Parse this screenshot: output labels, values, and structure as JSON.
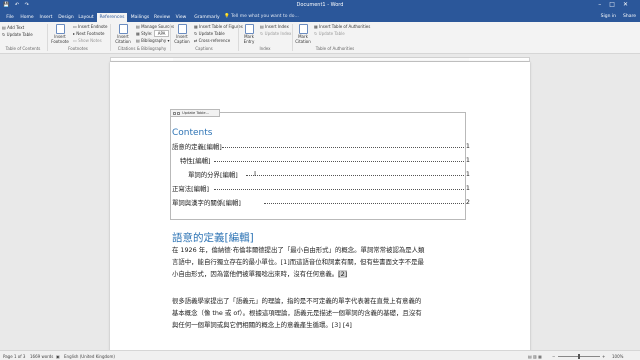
{
  "window": {
    "title": "Document1 - Word",
    "controls": {
      "minimize": "–",
      "maximize": "□",
      "close": "✕"
    }
  },
  "qat": {
    "icons": [
      "save-icon",
      "undo-icon",
      "redo-icon"
    ]
  },
  "tabs": [
    {
      "label": "File"
    },
    {
      "label": "Home"
    },
    {
      "label": "Insert"
    },
    {
      "label": "Design"
    },
    {
      "label": "Layout"
    },
    {
      "label": "References",
      "active": true
    },
    {
      "label": "Mailings"
    },
    {
      "label": "Review"
    },
    {
      "label": "View"
    },
    {
      "label": "Grammarly"
    }
  ],
  "tell_me": "Tell me what you want to do...",
  "sign_in": "Sign in",
  "share": "Share",
  "ribbon": {
    "toc": {
      "add_text": "Add Text",
      "update_table": "Update Table",
      "table_of_contents": "Table of Contents",
      "group": "Table of Contents"
    },
    "footnotes": {
      "insert_footnote": "Insert Footnote",
      "insert_endnote": "Insert Endnote",
      "next_footnote": "Next Footnote",
      "show_notes": "Show Notes",
      "group": "Footnotes"
    },
    "citations": {
      "insert_citation": "Insert Citation",
      "manage_sources": "Manage Sources",
      "style_label": "Style:",
      "style_value": "APA",
      "bibliography": "Bibliography",
      "group": "Citations & Bibliography"
    },
    "captions": {
      "insert_caption": "Insert Caption",
      "insert_table_of_figures": "Insert Table of Figures",
      "update_table": "Update Table",
      "cross_reference": "Cross-reference",
      "group": "Captions"
    },
    "index": {
      "mark_entry": "Mark Entry",
      "insert_index": "Insert Index",
      "update_index": "Update Index",
      "group": "Index"
    },
    "authorities": {
      "mark_citation": "Mark Citation",
      "insert_table_of_authorities": "Insert Table of Authorities",
      "update_table": "Update Table",
      "group": "Table of Authorities"
    }
  },
  "document": {
    "toc_tab_label": "Update Table...",
    "toc_title": "Contents",
    "toc_entries": [
      {
        "text": "語意的定義[編輯]",
        "page": "1",
        "level": 1
      },
      {
        "text": "特性[編輯]",
        "page": "1",
        "level": 2
      },
      {
        "text": "單詞的分界[編輯]",
        "page": "1",
        "level": 3
      },
      {
        "text": "正寫法[編輯]",
        "page": "1",
        "level": 1
      },
      {
        "text": "單詞與漢字的關係[編輯]",
        "page": "2",
        "level": 1
      }
    ],
    "heading": "語意的定義[編輯]",
    "paragraph1_lines": [
      "在 1926 年，倫納德·布倫菲爾德提出了「最小自由形式」的概念。單詞常常被認為是人類",
      "言語中，能自行獨立存在的最小單位。[1]而這語音位和詞素有關，但有些書面文字不是最",
      "小自由形式，因為當他們被單獨唸出來時，沒有任何意義。"
    ],
    "paragraph1_citation": "[2]",
    "paragraph2_lines": [
      "很多語義學家提出了「語義元」的理論，指的是不可定義的單字代表著在直覺上有意義的",
      "基本概念（像 the 或 of）。根據這項理論，語義元是描述一個單詞的含義的基礎，且沒有",
      "與任何一個單詞或與它們相關的概念上的意義產生循環。[3] [4]"
    ]
  },
  "status": {
    "page": "Page 1 of 3",
    "words": "1669 words",
    "language": "English (United Kingdom)",
    "zoom": "100%"
  }
}
